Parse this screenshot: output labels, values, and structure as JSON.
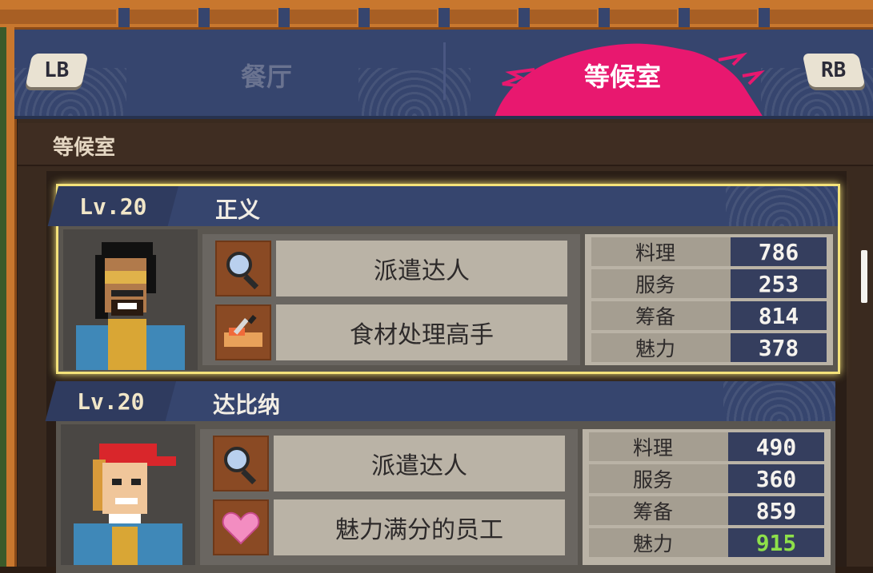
{
  "header": {
    "lb_label": "LB",
    "rb_label": "RB",
    "tabs": [
      {
        "label": "餐厅",
        "active": false
      },
      {
        "label": "等候室",
        "active": true
      }
    ],
    "active_accent": "#e8186f"
  },
  "section": {
    "title": "等候室"
  },
  "staff": [
    {
      "level": "Lv.20",
      "name": "正义",
      "selected": true,
      "skills": [
        {
          "icon": "magnifier-icon",
          "label": "派遣达人"
        },
        {
          "icon": "knife-cutting-board-icon",
          "label": "食材处理高手"
        }
      ],
      "stats": [
        {
          "label": "料理",
          "value": "786",
          "highlight": false
        },
        {
          "label": "服务",
          "value": "253",
          "highlight": false
        },
        {
          "label": "筹备",
          "value": "814",
          "highlight": false
        },
        {
          "label": "魅力",
          "value": "378",
          "highlight": false
        }
      ]
    },
    {
      "level": "Lv.20",
      "name": "达比纳",
      "selected": false,
      "skills": [
        {
          "icon": "magnifier-icon",
          "label": "派遣达人"
        },
        {
          "icon": "heart-icon",
          "label": "魅力满分的员工"
        }
      ],
      "stats": [
        {
          "label": "料理",
          "value": "490",
          "highlight": false
        },
        {
          "label": "服务",
          "value": "360",
          "highlight": false
        },
        {
          "label": "筹备",
          "value": "859",
          "highlight": false
        },
        {
          "label": "魅力",
          "value": "915",
          "highlight": true
        }
      ]
    }
  ]
}
